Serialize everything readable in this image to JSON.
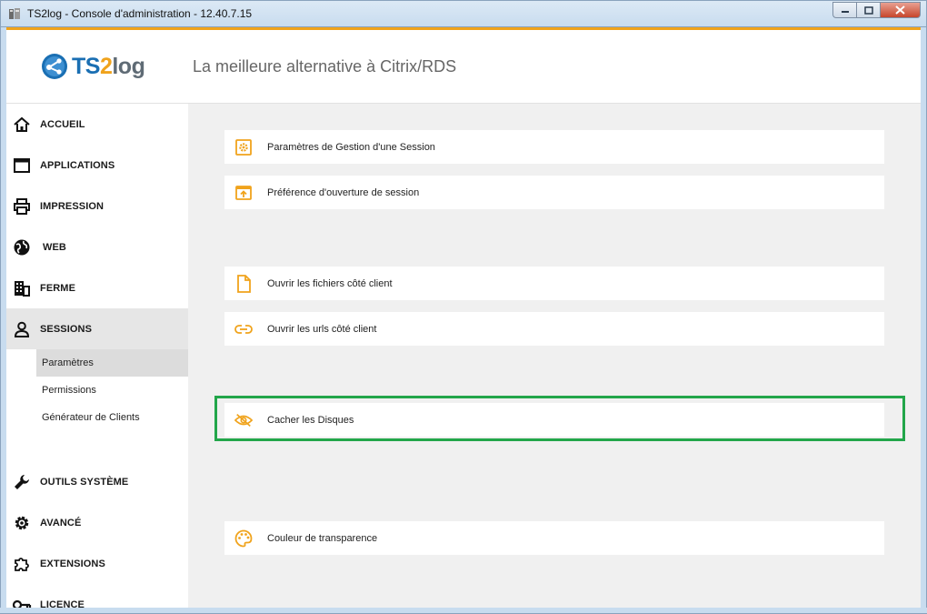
{
  "window": {
    "title": "TS2log - Console d'administration - 12.40.7.15"
  },
  "header": {
    "logo_ts": "TS",
    "logo_2": "2",
    "logo_log": "log",
    "tagline": "La meilleure alternative à Citrix/RDS"
  },
  "sidebar": {
    "items": [
      {
        "label": "ACCUEIL",
        "icon": "home-icon"
      },
      {
        "label": "APPLICATIONS",
        "icon": "window-icon"
      },
      {
        "label": "IMPRESSION",
        "icon": "printer-icon"
      },
      {
        "label": "WEB",
        "icon": "globe-icon"
      },
      {
        "label": "FERME",
        "icon": "building-icon"
      },
      {
        "label": "SESSIONS",
        "icon": "user-icon",
        "active": true
      },
      {
        "label": "OUTILS SYSTÈME",
        "icon": "wrench-icon"
      },
      {
        "label": "AVANCÉ",
        "icon": "gear-icon"
      },
      {
        "label": "EXTENSIONS",
        "icon": "puzzle-icon"
      },
      {
        "label": "LICENCE",
        "icon": "key-icon"
      }
    ],
    "sessions_subitems": [
      {
        "label": "Paramètres",
        "active": true
      },
      {
        "label": "Permissions"
      },
      {
        "label": "Générateur de Clients"
      }
    ]
  },
  "main": {
    "options": [
      {
        "label": "Paramètres de Gestion d'une Session",
        "icon": "settings-box-icon"
      },
      {
        "label": "Préférence d'ouverture de session",
        "icon": "login-box-icon"
      },
      {
        "label": "Ouvrir les fichiers côté client",
        "icon": "file-icon"
      },
      {
        "label": "Ouvrir les urls côté client",
        "icon": "link-icon"
      },
      {
        "label": "Cacher les Disques",
        "icon": "eye-off-icon",
        "highlighted": true
      },
      {
        "label": "Couleur de transparence",
        "icon": "palette-icon"
      }
    ]
  },
  "colors": {
    "accent": "#f0a31c",
    "brand_blue": "#1a6fb3",
    "highlight": "#22a64a",
    "panel_bg": "#f0f0f0"
  }
}
